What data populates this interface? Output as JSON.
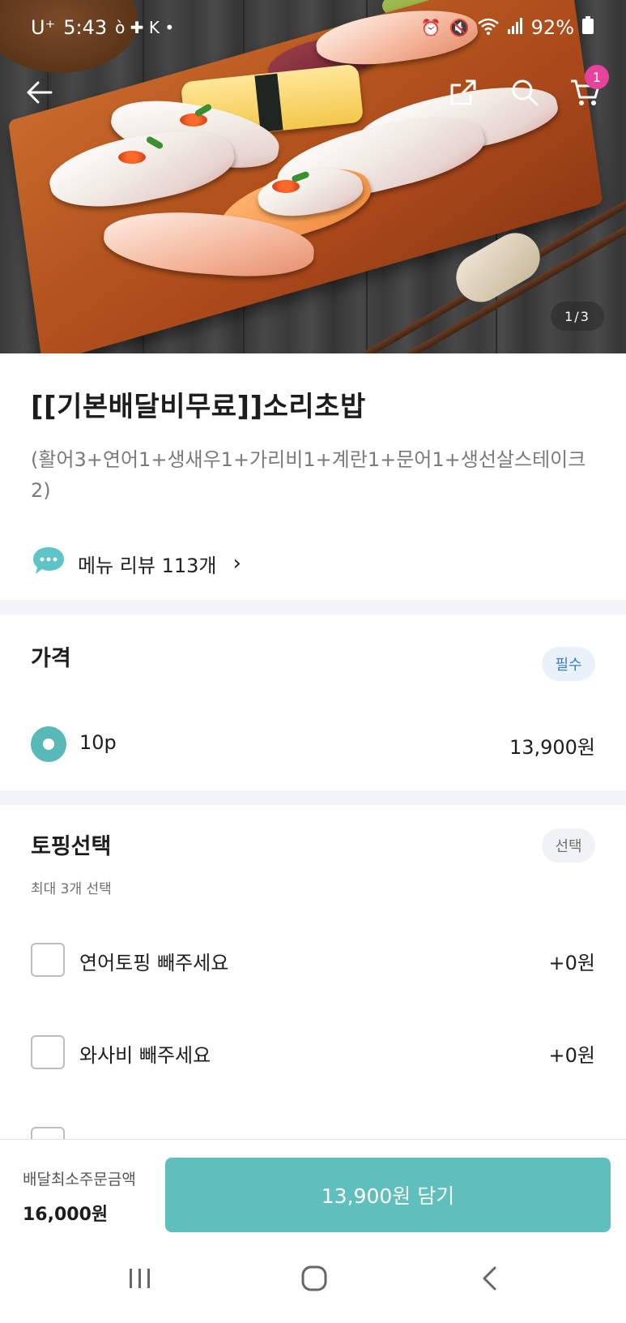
{
  "status_bar": {
    "carrier": "U⁺",
    "time": "5:43",
    "battery": "92%"
  },
  "header": {
    "cart_count": "1",
    "image_pager": "1/3"
  },
  "menu": {
    "title": "[[기본배달비무료]]소리초밥",
    "description": "(활어3+연어1+생새우1+가리비1+계란1+문어1+생선살스테이크2)",
    "review_link": "메뉴 리뷰 113개"
  },
  "price_section": {
    "title": "가격",
    "badge": "필수",
    "options": [
      {
        "label": "10p",
        "price": "13,900원",
        "selected": true
      }
    ]
  },
  "topping_section": {
    "title": "토핑선택",
    "badge": "선택",
    "subtitle": "최대 3개 선택",
    "options": [
      {
        "label": "연어토핑 빼주세요",
        "price": "+0원",
        "checked": false
      },
      {
        "label": "와사비 빼주세요",
        "price": "+0원",
        "checked": false
      }
    ]
  },
  "bottom_bar": {
    "min_order_label": "배달최소주문금액",
    "min_order_value": "16,000원",
    "add_button": "13,900원 담기"
  },
  "colors": {
    "accent": "#5fbfbd",
    "cart_badge": "#e8439c",
    "required_badge_text": "#3a7cc7"
  }
}
